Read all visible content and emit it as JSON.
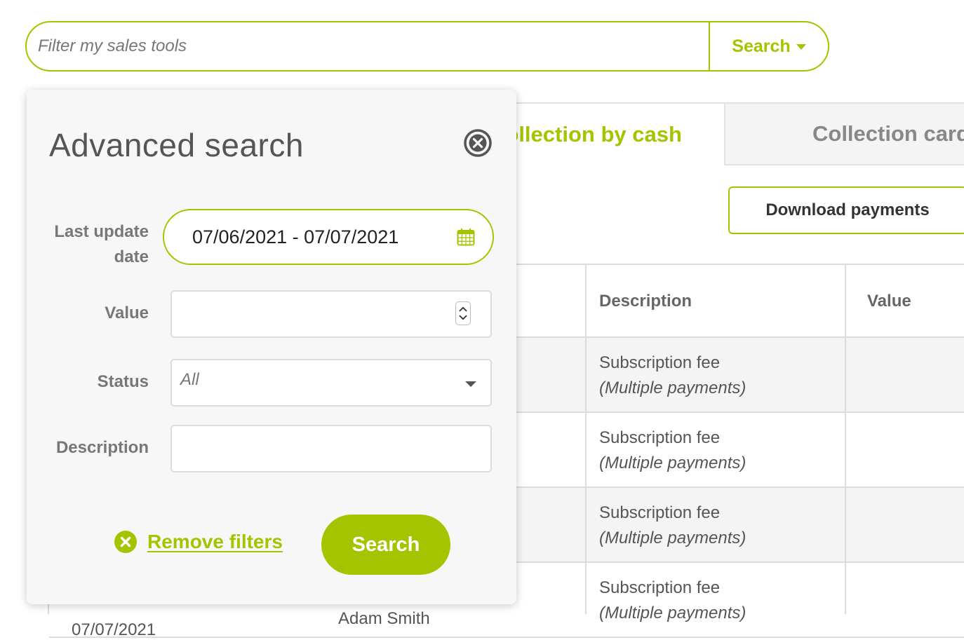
{
  "colors": {
    "accent": "#a5c400",
    "panel_bg": "#f7f7f7",
    "row_alt": "#f4f4f4"
  },
  "filter_bar": {
    "placeholder": "Filter my sales tools",
    "search_label": "Search",
    "search_icon": "caret-down-icon"
  },
  "tabs": [
    {
      "label": "Collection by cash",
      "active": true
    },
    {
      "label": "Collection card",
      "active": false
    }
  ],
  "download_button": {
    "label": "Download payments"
  },
  "table": {
    "headers": {
      "description": "Description",
      "value": "Value"
    },
    "rows": [
      {
        "description": "Subscription fee",
        "note": "(Multiple payments)"
      },
      {
        "description": "Subscription fee",
        "note": "(Multiple payments)"
      },
      {
        "description": "Subscription fee",
        "note": "(Multiple payments)"
      },
      {
        "description": "Subscription fee",
        "note": "(Multiple payments)",
        "date": "07/07/2021",
        "name": "Adam Smith"
      }
    ]
  },
  "advanced_search": {
    "title": "Advanced search",
    "close_icon": "close-circle-icon",
    "fields": {
      "last_update_label_1": "Last update",
      "last_update_label_2": "date",
      "date_range": "07/06/2021 - 07/07/2021",
      "value_label": "Value",
      "value": "",
      "status_label": "Status",
      "status_value": "All",
      "description_label": "Description",
      "description_value": ""
    },
    "remove_filters_label": "Remove filters",
    "search_button_label": "Search"
  }
}
